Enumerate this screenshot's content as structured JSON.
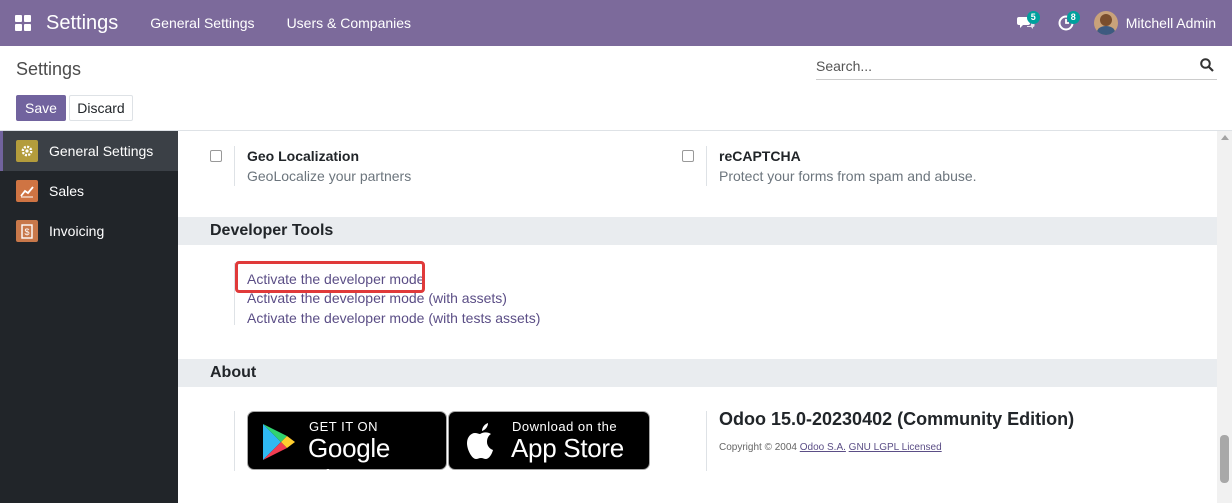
{
  "navbar": {
    "app_title": "Settings",
    "menu": [
      "General Settings",
      "Users & Companies"
    ],
    "messages_count": "5",
    "activities_count": "8",
    "user_name": "Mitchell Admin",
    "color": "#7c6a9b"
  },
  "control_panel": {
    "title": "Settings",
    "search_placeholder": "Search...",
    "save_label": "Save",
    "discard_label": "Discard"
  },
  "sidebar": {
    "items": [
      {
        "label": "General Settings",
        "icon": "gear-icon",
        "color": "#b39c3c",
        "active": true
      },
      {
        "label": "Sales",
        "icon": "chart-icon",
        "color": "#cf7443"
      },
      {
        "label": "Invoicing",
        "icon": "invoice-icon",
        "color": "#c8784a"
      }
    ]
  },
  "settings": {
    "geo": {
      "title": "Geo Localization",
      "desc": "GeoLocalize your partners"
    },
    "recaptcha": {
      "title": "reCAPTCHA",
      "desc": "Protect your forms from spam and abuse."
    }
  },
  "developer_tools": {
    "header": "Developer Tools",
    "links": [
      "Activate the developer mode",
      "Activate the developer mode (with assets)",
      "Activate the developer mode (with tests assets)"
    ]
  },
  "about": {
    "header": "About",
    "google_play_small": "GET IT ON",
    "google_play_big": "Google Play",
    "app_store_small": "Download on the",
    "app_store_big": "App Store",
    "version": "Odoo 15.0-20230402 (Community Edition)",
    "copyright_prefix": "Copyright © 2004",
    "company_link": "Odoo S.A.",
    "license_link": "GNU LGPL Licensed"
  }
}
